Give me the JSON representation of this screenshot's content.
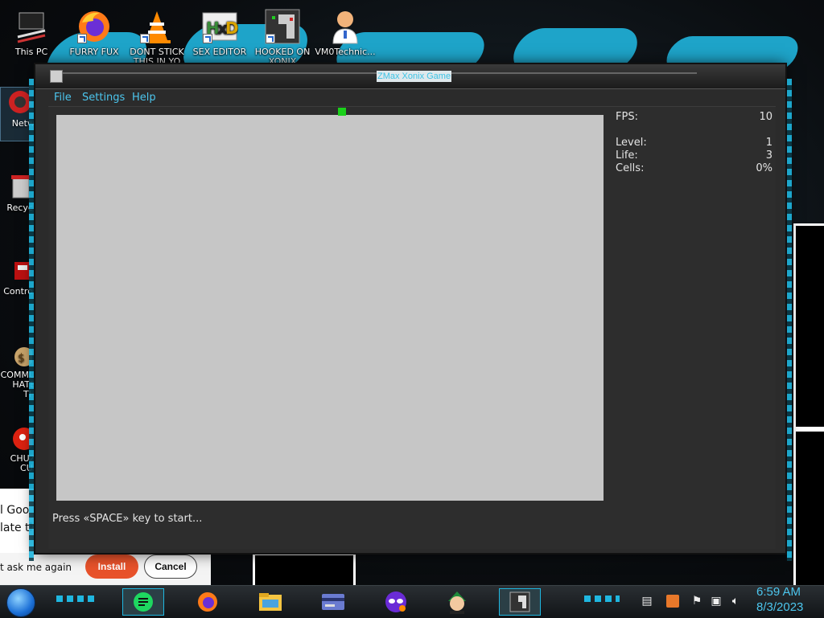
{
  "desktop": {
    "top_icons": [
      {
        "label": "This PC",
        "icon": "pc-icon"
      },
      {
        "label": "FURRY FUX",
        "icon": "firefox-icon"
      },
      {
        "label": "DONT STICK THIS IN YO",
        "icon": "vlc-cone-icon"
      },
      {
        "label": "SEX EDITOR",
        "icon": "hxd-editor-icon"
      },
      {
        "label": "HOOKED ON XONIX",
        "icon": "xonix-icon"
      },
      {
        "label": "VM0Technic...",
        "icon": "doctor-icon"
      }
    ],
    "side_icons": [
      {
        "label": "Netw",
        "icon": "network-icon"
      },
      {
        "label": "Recycl",
        "icon": "recycle-bin-icon"
      },
      {
        "label": "Control",
        "icon": "control-panel-icon"
      },
      {
        "label": "COMMU HATE TH",
        "icon": "money-bag-icon"
      },
      {
        "label": "CHUZ CUI",
        "icon": "red-creature-icon"
      }
    ]
  },
  "notification": {
    "line1": "l Goo",
    "line2": "late th",
    "dont_ask": "t ask me again",
    "install": "Install",
    "cancel": "Cancel"
  },
  "window": {
    "title": "ZMax Xonix Game",
    "menu": [
      "File",
      "Settings",
      "Help"
    ]
  },
  "game": {
    "stats": {
      "fps_label": "FPS:",
      "fps": "10",
      "level_label": "Level:",
      "level": "1",
      "life_label": "Life:",
      "life": "3",
      "cells_label": "Cells:",
      "cells": "0%"
    },
    "status": "Press «SPACE» key to start...",
    "colors": {
      "field": "#c6c6c6",
      "player": "#1ad01a",
      "panel": "#2d2d2d"
    }
  },
  "taskbar": {
    "items": [
      "notes-app-icon",
      "firefox-icon",
      "file-explorer-icon",
      "card-app-icon",
      "mask-app-icon",
      "anime-avatar-icon",
      "xonix-icon"
    ],
    "tray": [
      "chevron-icon",
      "app-tray-icon",
      "flag-icon",
      "network-icon",
      "volume-icon"
    ],
    "time": "6:59 AM",
    "date": "8/3/2023"
  }
}
